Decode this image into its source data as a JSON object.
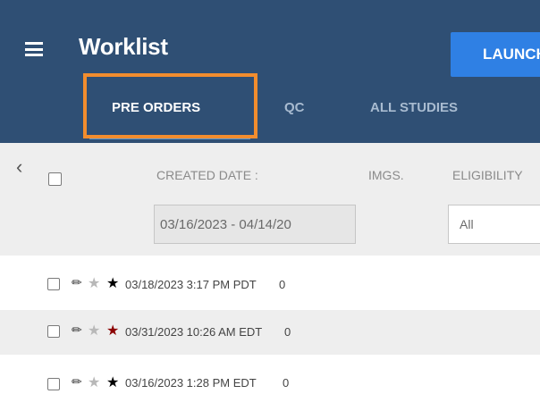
{
  "header": {
    "title": "Worklist",
    "launch_label": "LAUNCH",
    "menu_icon": "hamburger-menu-icon"
  },
  "tabs": [
    {
      "label": "PRE ORDERS",
      "active": true
    },
    {
      "label": "QC",
      "active": false
    },
    {
      "label": "ALL STUDIES",
      "active": false
    }
  ],
  "filters": {
    "columns": {
      "created_date": "CREATED DATE :",
      "imgs": "IMGS.",
      "eligibility": "ELIGIBILITY"
    },
    "date_range_value": "03/16/2023 - 04/14/20",
    "eligibility_value": "All"
  },
  "rows": [
    {
      "date": "03/18/2023 3:17 PM PDT",
      "imgs": "0",
      "priority_star_color": "#000000",
      "checked": false
    },
    {
      "date": "03/31/2023 10:26 AM EDT",
      "imgs": "0",
      "priority_star_color": "#8b0000",
      "checked": false
    },
    {
      "date": "03/16/2023 1:28 PM EDT",
      "imgs": "0",
      "priority_star_color": "#000000",
      "checked": false
    }
  ],
  "colors": {
    "header_bg": "#2f4f74",
    "launch_bg": "#2f80e4",
    "highlight": "#f28d2e",
    "tab_indicator": "#5b9bd5"
  }
}
